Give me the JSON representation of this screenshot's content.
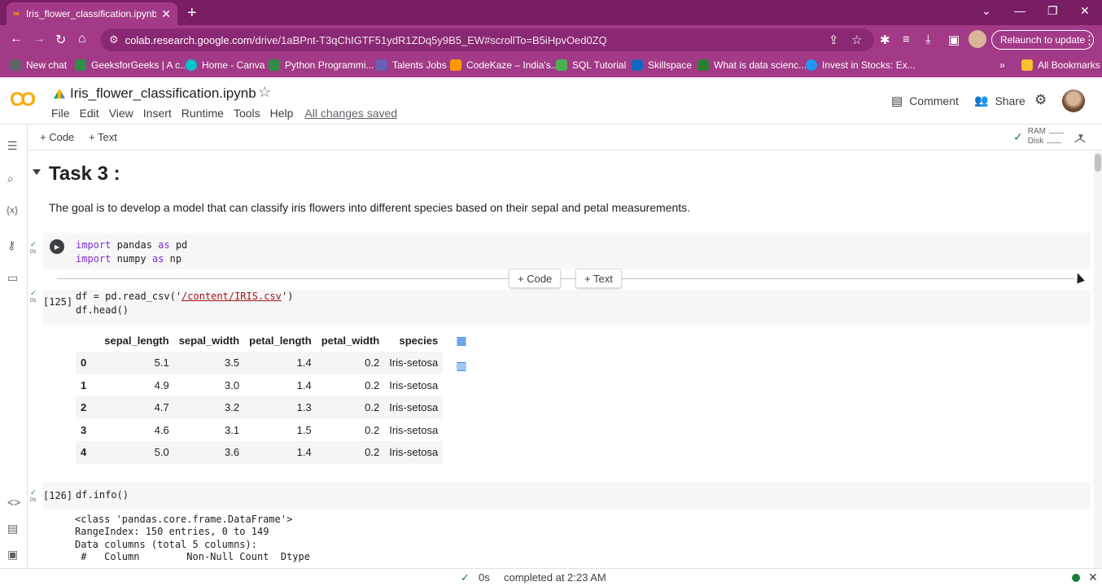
{
  "browser": {
    "tab_title": "Iris_flower_classification.ipynb - ",
    "url_host": "colab.research.google.com",
    "url_path": "/drive/1aBPnt-T3qChIGTF51ydR1ZDq5y9B5_EW#scrollTo=B5iHpvOed0ZQ",
    "relaunch_label": "Relaunch to update",
    "bookmarks": [
      "New chat",
      "GeeksforGeeks | A c...",
      "Home - Canva",
      "Python Programmi...",
      "Talents Jobs",
      "CodeKaze – India's...",
      "SQL Tutorial",
      "Skillspace",
      "What is data scienc...",
      "Invest in Stocks: Ex..."
    ],
    "all_bookmarks_label": "All Bookmarks",
    "more_bookmarks_label": "»"
  },
  "colab": {
    "logo": "CO",
    "notebook_title": "Iris_flower_classification.ipynb",
    "menu": [
      "File",
      "Edit",
      "View",
      "Insert",
      "Runtime",
      "Tools",
      "Help"
    ],
    "saved_status": "All changes saved",
    "comment_label": "Comment",
    "share_label": "Share"
  },
  "toolbar": {
    "add_code": "+ Code",
    "add_text": "+ Text",
    "ram_label": "RAM",
    "disk_label": "Disk"
  },
  "notebook": {
    "heading": "Task 3 :",
    "goal_text": "The goal is to develop a model that can classify iris flowers into different species based on their sepal and petal measurements.",
    "cell1": {
      "line1_kw1": "import",
      "line1_mod": " pandas ",
      "line1_kw2": "as",
      "line1_alias": " pd",
      "line2_kw1": "import",
      "line2_mod": " numpy ",
      "line2_kw2": "as",
      "line2_alias": " np",
      "status_time": "0s"
    },
    "float_code": "+ Code",
    "float_text": "+ Text",
    "cell2": {
      "exec_count": "[125]",
      "line1_pre": "df = pd.read_csv('",
      "line1_str": "/content/IRIS.csv",
      "line1_post": "')",
      "line2": "df.head()",
      "status_time": "0s"
    },
    "dataframe": {
      "columns": [
        "sepal_length",
        "sepal_width",
        "petal_length",
        "petal_width",
        "species"
      ],
      "rows": [
        {
          "index": "0",
          "values": [
            "5.1",
            "3.5",
            "1.4",
            "0.2",
            "Iris-setosa"
          ]
        },
        {
          "index": "1",
          "values": [
            "4.9",
            "3.0",
            "1.4",
            "0.2",
            "Iris-setosa"
          ]
        },
        {
          "index": "2",
          "values": [
            "4.7",
            "3.2",
            "1.3",
            "0.2",
            "Iris-setosa"
          ]
        },
        {
          "index": "3",
          "values": [
            "4.6",
            "3.1",
            "1.5",
            "0.2",
            "Iris-setosa"
          ]
        },
        {
          "index": "4",
          "values": [
            "5.0",
            "3.6",
            "1.4",
            "0.2",
            "Iris-setosa"
          ]
        }
      ]
    },
    "cell3": {
      "exec_count": "[126]",
      "code": "df.info()",
      "status_time": "0s",
      "output_lines": [
        "<class 'pandas.core.frame.DataFrame'>",
        "RangeIndex: 150 entries, 0 to 149",
        "Data columns (total 5 columns):",
        " #   Column        Non-Null Count  Dtype"
      ]
    }
  },
  "statusbar": {
    "time": "0s",
    "completed": "completed at 2:23 AM"
  }
}
